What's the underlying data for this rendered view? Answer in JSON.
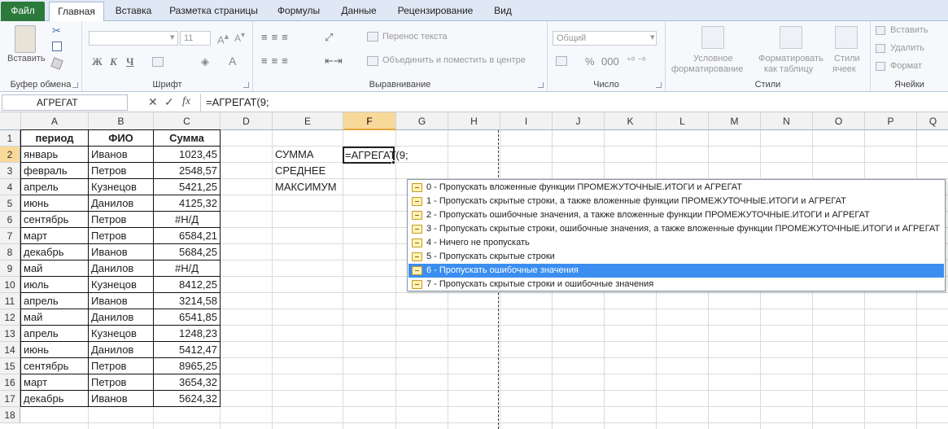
{
  "tabs": [
    "Файл",
    "Главная",
    "Вставка",
    "Разметка страницы",
    "Формулы",
    "Данные",
    "Рецензирование",
    "Вид"
  ],
  "ribbon": {
    "clipboard": {
      "paste_label": "Вставить",
      "group_label": "Буфер обмена"
    },
    "font": {
      "font_name": "",
      "font_size": "11",
      "bold": "Ж",
      "italic": "К",
      "underline": "Ч",
      "group_label": "Шрифт"
    },
    "alignment": {
      "wrap_text": "Перенос текста",
      "merge_center": "Объединить и поместить в центре",
      "group_label": "Выравнивание"
    },
    "number": {
      "format": "Общий",
      "group_label": "Число"
    },
    "styles": {
      "conditional": "Условное форматирование",
      "conditional_1": "Условное",
      "conditional_2": "форматирование",
      "format_table_1": "Форматировать",
      "format_table_2": "как таблицу",
      "cell_styles_1": "Стили",
      "cell_styles_2": "ячеек",
      "group_label": "Стили"
    },
    "cells": {
      "insert": "Вставить",
      "delete": "Удалить",
      "format": "Формат",
      "group_label": "Ячейки"
    }
  },
  "formula_bar": {
    "name_box": "АГРЕГАТ",
    "formula": "=АГРЕГАТ(9;",
    "fx": "fx"
  },
  "columns": [
    "A",
    "B",
    "C",
    "D",
    "E",
    "F",
    "G",
    "H",
    "I",
    "J",
    "K",
    "L",
    "M",
    "N",
    "O",
    "P",
    "Q"
  ],
  "rows": [
    "1",
    "2",
    "3",
    "4",
    "5",
    "6",
    "7",
    "8",
    "9",
    "10",
    "11",
    "12",
    "13",
    "14",
    "15",
    "16",
    "17",
    "18"
  ],
  "table": {
    "headers": [
      "период",
      "ФИО",
      "Сумма"
    ],
    "rows": [
      [
        "январь",
        "Иванов",
        "1023,45"
      ],
      [
        "февраль",
        "Петров",
        "2548,57"
      ],
      [
        "апрель",
        "Кузнецов",
        "5421,25"
      ],
      [
        "июнь",
        "Данилов",
        "4125,32"
      ],
      [
        "сентябрь",
        "Петров",
        "#Н/Д"
      ],
      [
        "март",
        "Петров",
        "6584,21"
      ],
      [
        "декабрь",
        "Иванов",
        "5684,25"
      ],
      [
        "май",
        "Данилов",
        "#Н/Д"
      ],
      [
        "июль",
        "Кузнецов",
        "8412,25"
      ],
      [
        "апрель",
        "Иванов",
        "3214,58"
      ],
      [
        "май",
        "Данилов",
        "6541,85"
      ],
      [
        "апрель",
        "Кузнецов",
        "1248,23"
      ],
      [
        "июнь",
        "Данилов",
        "5412,47"
      ],
      [
        "сентябрь",
        "Петров",
        "8965,25"
      ],
      [
        "март",
        "Петров",
        "3654,32"
      ],
      [
        "декабрь",
        "Иванов",
        "5624,32"
      ]
    ]
  },
  "labels": {
    "sum": "СУММА",
    "avg": "СРЕДНЕЕ",
    "max": "МАКСИМУМ"
  },
  "active_cell_value": "=АГРЕГАТ(9;",
  "autocomplete": {
    "items": [
      "0 - Пропускать вложенные функции ПРОМЕЖУТОЧНЫЕ.ИТОГИ и АГРЕГАТ",
      "1 - Пропускать скрытые строки, а также вложенные функции ПРОМЕЖУТОЧНЫЕ.ИТОГИ и АГРЕГАТ",
      "2 - Пропускать ошибочные значения, а также вложенные функции ПРОМЕЖУТОЧНЫЕ.ИТОГИ и АГРЕГАТ",
      "3 - Пропускать скрытые строки, ошибочные значения, а также вложенные функции ПРОМЕЖУТОЧНЫЕ.ИТОГИ и АГРЕГАТ",
      "4 - Ничего не пропускать",
      "5 - Пропускать скрытые строки",
      "6 - Пропускать ошибочные значения",
      "7 - Пропускать скрытые строки и ошибочные значения"
    ],
    "selected_index": 6
  },
  "colors": {
    "selected": "#3b8ef0",
    "file_tab": "#2b7a3c",
    "header_highlight": "#f9d99a"
  }
}
